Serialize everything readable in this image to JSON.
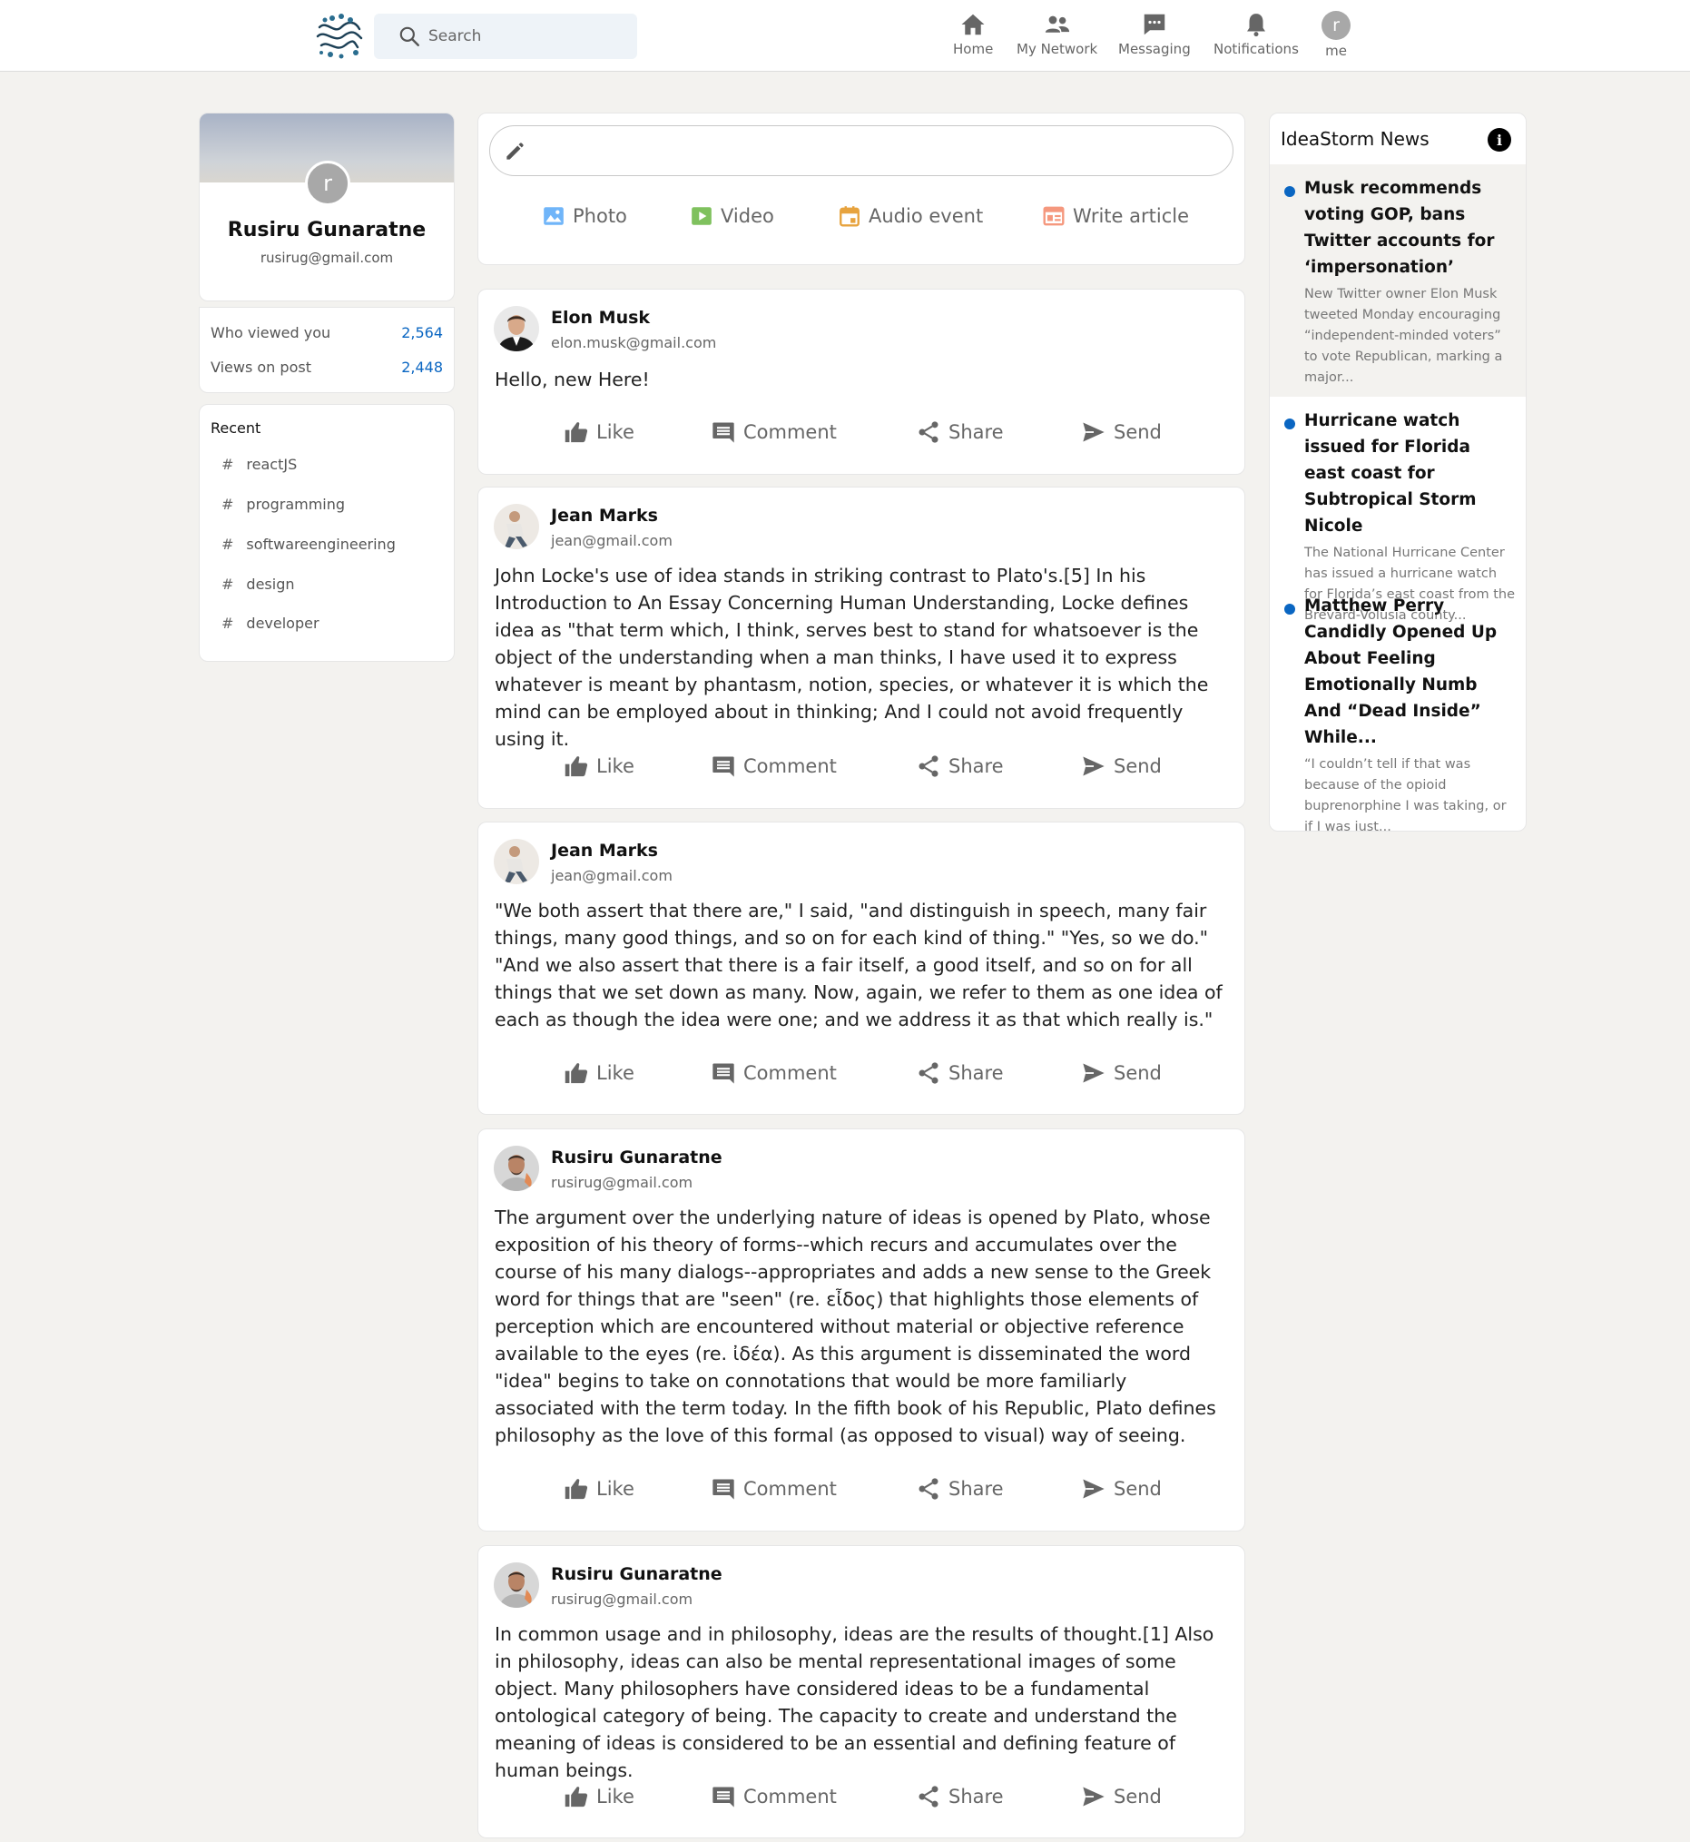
{
  "header": {
    "search_placeholder": "Search",
    "nav": [
      {
        "label": "Home",
        "icon": "home-icon"
      },
      {
        "label": "My Network",
        "icon": "people-icon"
      },
      {
        "label": "Messaging",
        "icon": "messaging-icon"
      },
      {
        "label": "Notifications",
        "icon": "bell-icon"
      },
      {
        "label": "me",
        "icon": "avatar",
        "initial": "r"
      }
    ]
  },
  "profile": {
    "initial": "r",
    "name": "Rusiru Gunaratne",
    "email": "rusirug@gmail.com",
    "stats": [
      {
        "label": "Who viewed you",
        "value": "2,564"
      },
      {
        "label": "Views on post",
        "value": "2,448"
      }
    ]
  },
  "recent": {
    "title": "Recent",
    "tags": [
      "reactJS",
      "programming",
      "softwareengineering",
      "design",
      "developer"
    ]
  },
  "share": {
    "buttons": [
      {
        "label": "Photo",
        "icon": "photo-icon",
        "color": "#70b5f9"
      },
      {
        "label": "Video",
        "icon": "video-icon",
        "color": "#7fc15e"
      },
      {
        "label": "Audio event",
        "icon": "calendar-icon",
        "color": "#e7a33e"
      },
      {
        "label": "Write article",
        "icon": "article-icon",
        "color": "#fc9295"
      }
    ]
  },
  "actions": {
    "like": "Like",
    "comment": "Comment",
    "share": "Share",
    "send": "Send"
  },
  "posts": [
    {
      "author": "Elon Musk",
      "email": "elon.musk@gmail.com",
      "text": "Hello, new Here!"
    },
    {
      "author": "Jean Marks",
      "email": "jean@gmail.com",
      "text": "John Locke's use of idea stands in striking contrast to Plato's.[5] In his Introduction to An Essay Concerning Human Understanding, Locke defines idea as \"that term which, I think, serves best to stand for whatsoever is the object of the understanding when a man thinks, I have used it to express whatever is meant by phantasm, notion, species, or whatever it is which the mind can be employed about in thinking; And I could not avoid frequently using it."
    },
    {
      "author": "Jean Marks",
      "email": "jean@gmail.com",
      "text": "\"We both assert that there are,\" I said, \"and distinguish in speech, many fair things, many good things, and so on for each kind of thing.\" \"Yes, so we do.\" \"And we also assert that there is a fair itself, a good itself, and so on for all things that we set down as many. Now, again, we refer to them as one idea of each as though the idea were one; and we address it as that which really is.\""
    },
    {
      "author": "Rusiru Gunaratne",
      "email": "rusirug@gmail.com",
      "text": "The argument over the underlying nature of ideas is opened by Plato, whose exposition of his theory of forms--which recurs and accumulates over the course of his many dialogs--appropriates and adds a new sense to the Greek word for things that are \"seen\" (re. εἶδος) that highlights those elements of perception which are encountered without material or objective reference available to the eyes (re. ἰδέα). As this argument is disseminated the word \"idea\" begins to take on connotations that would be more familiarly associated with the term today. In the fifth book of his Republic, Plato defines philosophy as the love of this formal (as opposed to visual) way of seeing."
    },
    {
      "author": "Rusiru Gunaratne",
      "email": "rusirug@gmail.com",
      "text": "In common usage and in philosophy, ideas are the results of thought.[1] Also in philosophy, ideas can also be mental representational images of some object. Many philosophers have considered ideas to be a fundamental ontological category of being. The capacity to create and understand the meaning of ideas is considered to be an essential and defining feature of human beings."
    }
  ],
  "news": {
    "title": "IdeaStorm News",
    "info_glyph": "i",
    "items": [
      {
        "headline": "Musk recommends voting GOP, bans Twitter accounts for ‘impersonation’",
        "summary": "New Twitter owner Elon Musk tweeted Monday encouraging “independent-minded voters” to vote Republican, marking a major..."
      },
      {
        "headline": "Hurricane watch issued for Florida east coast for Subtropical Storm Nicole",
        "summary": "The National Hurricane Center has issued a hurricane watch for Florida’s east coast from the Brevard-Volusia county..."
      },
      {
        "headline": "Matthew Perry Candidly Opened Up About Feeling Emotionally Numb And “Dead Inside” While...",
        "summary": "“I couldn’t tell if that was because of the opioid buprenorphine I was taking, or if I was just..."
      }
    ]
  },
  "colors": {
    "accent": "#0a66c2",
    "background": "#f3f2ef",
    "icon_gray": "#666666"
  }
}
